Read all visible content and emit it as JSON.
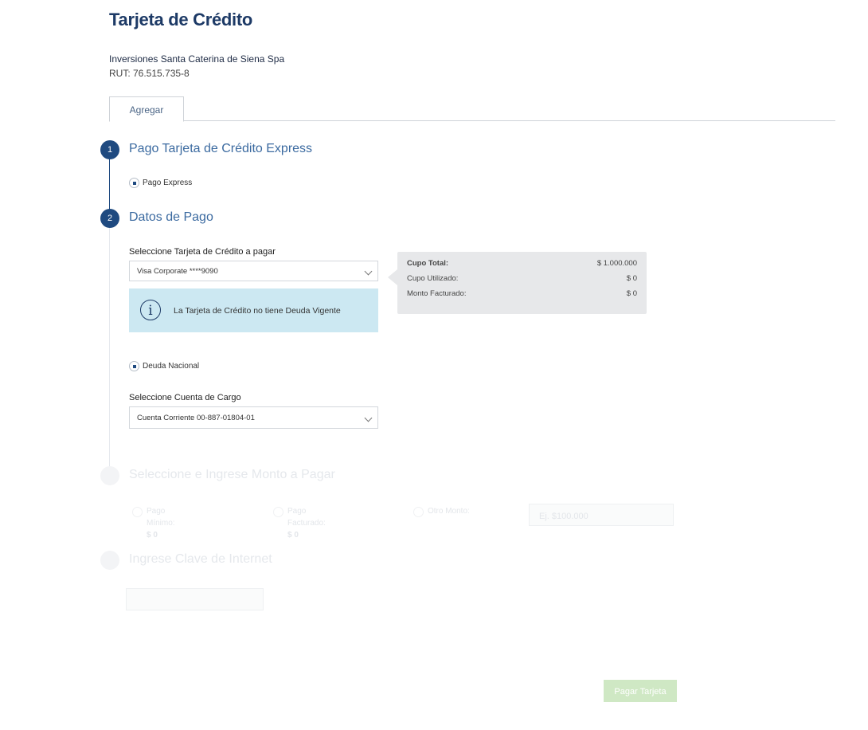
{
  "header": {
    "title": "Tarjeta de Crédito",
    "company": "Inversiones Santa Caterina de Siena Spa",
    "rut": "RUT: 76.515.735-8"
  },
  "tabs": [
    {
      "label": "Agregar"
    }
  ],
  "steps": [
    {
      "number": "1",
      "title": "Pago Tarjeta de Crédito Express"
    },
    {
      "number": "2",
      "title": "Datos de Pago"
    },
    {
      "number": "3",
      "title": "Seleccione e Ingrese Monto a Pagar"
    },
    {
      "number": "4",
      "title": "Ingrese Clave de Internet"
    }
  ],
  "step1": {
    "option_label": "Pago Express"
  },
  "step2": {
    "card_label": "Seleccione Tarjeta de Crédito a pagar",
    "card_value": "Visa Corporate ****9090",
    "info_message": "La Tarjeta de Crédito no tiene Deuda Vigente",
    "debt_option": "Deuda Nacional",
    "account_label": "Seleccione Cuenta de Cargo",
    "account_value": "Cuenta Corriente 00-887-01804-01"
  },
  "summary": {
    "rows": [
      {
        "label": "Cupo Total:",
        "value": "$ 1.000.000"
      },
      {
        "label": "Cupo Utilizado:",
        "value": "$ 0"
      },
      {
        "label": "Monto Facturado:",
        "value": "$ 0"
      }
    ]
  },
  "step3": {
    "options": [
      {
        "line1": "Pago",
        "line2": "Mínimo:",
        "amount": "$ 0"
      },
      {
        "line1": "Pago",
        "line2": "Facturado:",
        "amount": "$ 0"
      },
      {
        "line1": "Otro Monto:"
      }
    ],
    "amount_placeholder": "Ej. $100.000"
  },
  "pay_button": "Pagar Tarjeta",
  "colors": {
    "primary": "#1f4a80",
    "info_bg": "#cce8f2",
    "button_disabled": "#cfe8c4"
  }
}
